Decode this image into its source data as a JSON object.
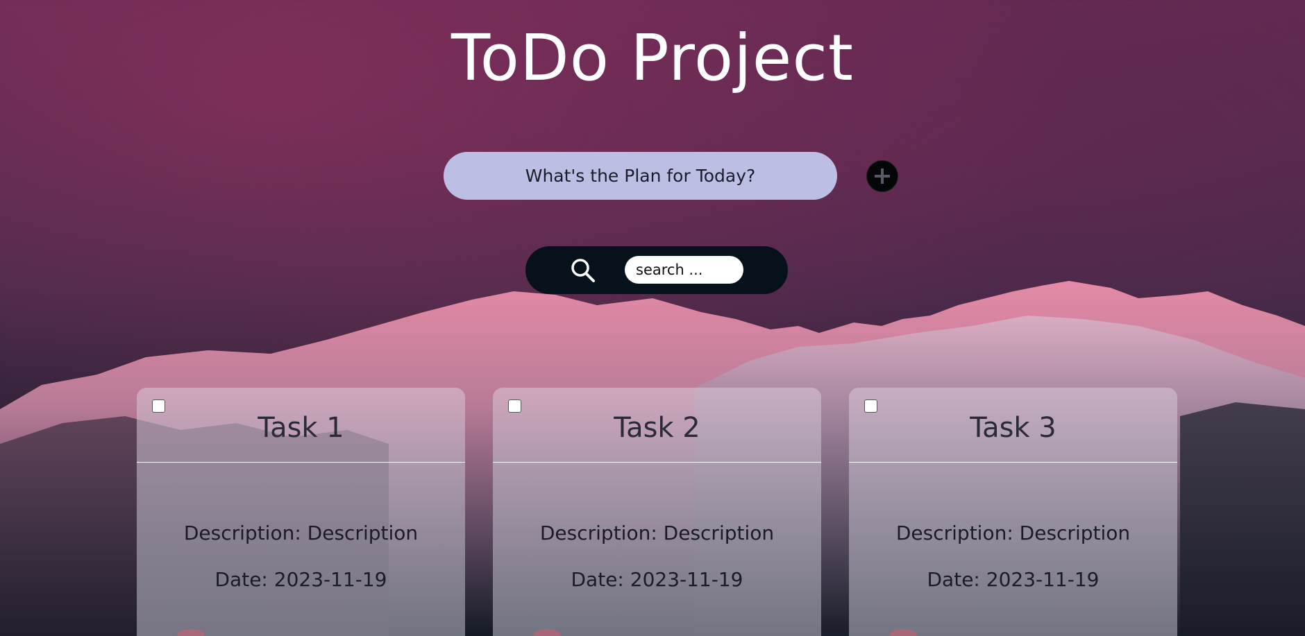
{
  "header": {
    "title": "ToDo Project"
  },
  "plan": {
    "placeholder": "What's the Plan for Today?"
  },
  "add_button": {
    "icon": "plus-icon"
  },
  "search": {
    "icon": "search-icon",
    "placeholder": "search ..."
  },
  "tasks": [
    {
      "title": "Task 1",
      "description": "Description: Description",
      "date": "Date: 2023-11-19",
      "checked": false
    },
    {
      "title": "Task 2",
      "description": "Description: Description",
      "date": "Date: 2023-11-19",
      "checked": false
    },
    {
      "title": "Task 3",
      "description": "Description: Description",
      "date": "Date: 2023-11-19",
      "checked": false
    }
  ],
  "colors": {
    "input_bg": "#bcbfe3",
    "search_bar_bg": "#07111c",
    "add_button_bg": "#050607",
    "title_text": "#ffffff"
  }
}
